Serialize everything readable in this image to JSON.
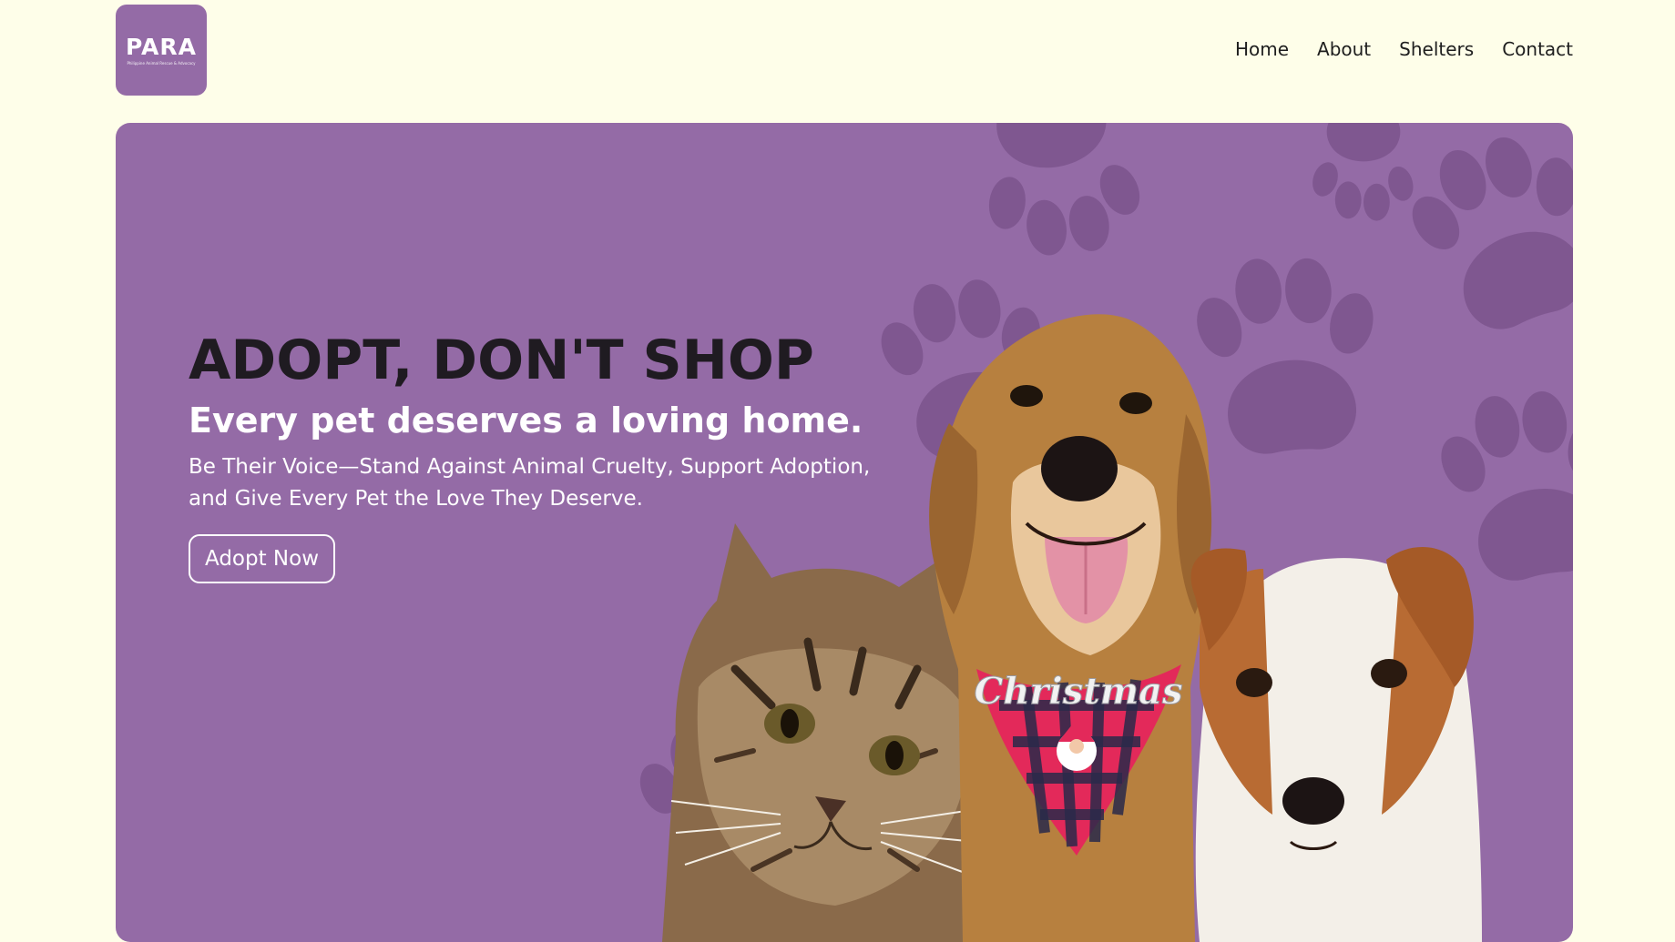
{
  "brand": {
    "logo_text": "PARA",
    "logo_tagline": "Philippine Animal Rescue & Advocacy"
  },
  "nav": {
    "items": [
      {
        "label": "Home"
      },
      {
        "label": "About"
      },
      {
        "label": "Shelters"
      },
      {
        "label": "Contact"
      }
    ]
  },
  "hero": {
    "headline": "ADOPT, DON'T SHOP",
    "subheadline": "Every pet deserves a loving home.",
    "description": "Be Their Voice—Stand Against Animal Cruelty, Support Adoption, and Give Every Pet the Love They Deserve.",
    "cta_label": "Adopt Now",
    "bandana_text": "Christmas"
  },
  "colors": {
    "page_background": "#fefee9",
    "brand_purple": "#946ba6",
    "paw_purple": "#7f5790",
    "headline": "#1f1b21",
    "nav_text": "#1e1e1e"
  },
  "icons": {
    "logo_paw": "paw-icon",
    "background_pattern": "paw-print-icon"
  }
}
